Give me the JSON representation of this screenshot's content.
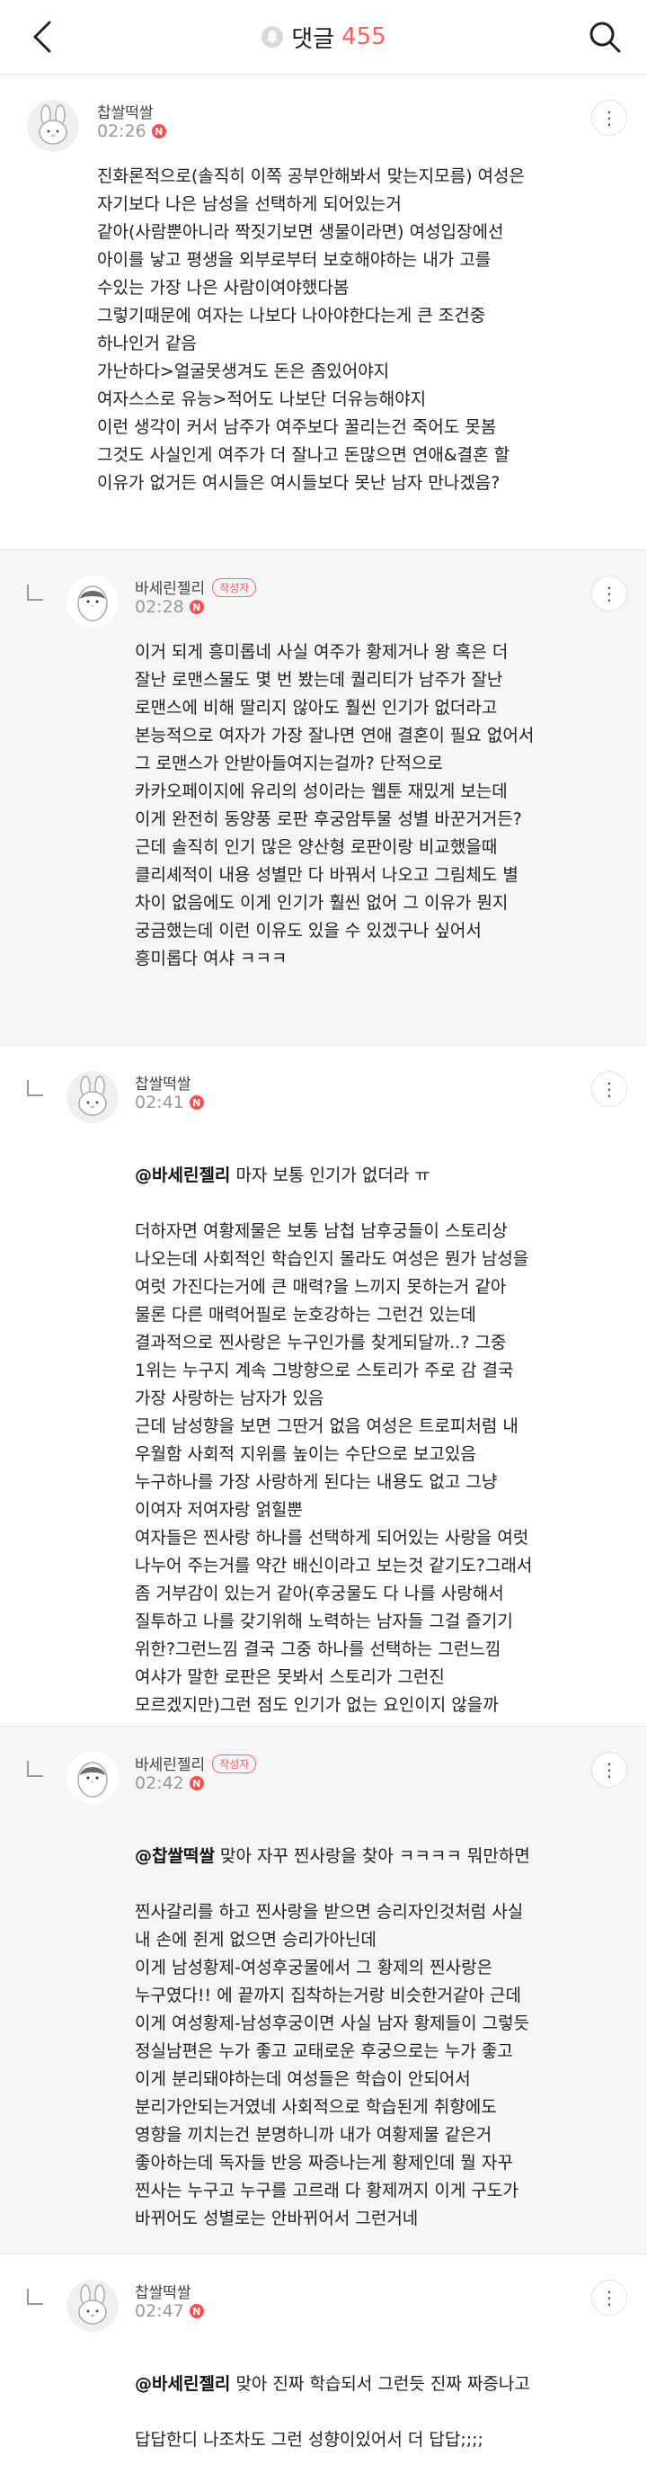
{
  "header": {
    "title": "댓글",
    "count": "455"
  },
  "comments": [
    {
      "author": "찹쌀떡쌀",
      "time": "02:26",
      "badge": "N",
      "body": "진화론적으로(솔직히 이쪽 공부안해봐서 맞는지모름) 여성은\n자기보다 나은 남성을 선택하게 되어있는거\n같아(사람뿐아니라 짝짓기보면 생물이라면) 여성입장에선\n아이를 낳고 평생을 외부로부터 보호해야하는 내가 고를\n수있는 가장 나은 사람이여야했다봄\n그렇기때문에 여자는 나보다 나아야한다는게 큰 조건중\n하나인거 같음\n가난하다>얼굴못생겨도 돈은 좀있어야지\n여자스스로 유능>적어도 나보단 더유능해야지\n이런 생각이 커서 남주가 여주보다 꿀리는건 죽어도 못봄\n그것도 사실인게 여주가 더 잘나고 돈많으면 연애&결혼 할\n이유가 없거든 여시들은 여시들보다 못난 남자 만나겠음?"
    },
    {
      "author": "바세린젤리",
      "tag": "작성자",
      "time": "02:28",
      "badge": "N",
      "body": "이거 되게 흥미롭네 사실 여주가 황제거나 왕 혹은 더\n잘난 로맨스물도 몇 번 봤는데 퀄리티가 남주가 잘난\n로맨스에 비해 딸리지 않아도 훨씬 인기가 없더라고\n본능적으로 여자가 가장 잘나면 연애 결혼이 필요 없어서\n그 로맨스가 안받아들여지는걸까? 단적으로\n카카오페이지에 유리의 성이라는 웹툰 재밌게 보는데\n이게 완전히 동양풍 로판 후궁암투물 성별 바꾼거거든?\n근데 솔직히 인기 많은 양산형 로판이랑 비교했을때\n클리셰적이 내용 성별만 다 바꿔서 나오고 그림체도 별\n차이 없음에도 이게 인기가 훨씬 없어 그 이유가 뭔지\n궁금했는데 이런 이유도 있을 수 있겠구나 싶어서\n흥미롭다 여샤 ㅋㅋㅋ"
    },
    {
      "author": "찹쌀떡쌀",
      "time": "02:41",
      "badge": "N",
      "mention": "@바세린젤리",
      "body_rest": " 마자 보통 인기가 없더라 ㅠ",
      "body": "더하자면 여황제물은 보통 남첩 남후궁들이 스토리상\n나오는데 사회적인 학습인지 몰라도 여성은 뭔가 남성을\n여럿 가진다는거에 큰 매력?을 느끼지 못하는거 같아\n물론 다른 매력어필로 눈호강하는 그런건 있는데\n결과적으로 찐사랑은 누구인가를 찾게되달까..? 그중\n1위는 누구지 계속 그방향으로 스토리가 주로 감 결국\n가장 사랑하는 남자가 있음\n근데 남성향을 보면 그딴거 없음 여성은 트로피처럼 내\n우월함 사회적 지위를 높이는 수단으로 보고있음\n누구하나를 가장 사랑하게 된다는 내용도 없고 그냥\n이여자 저여자랑 얽힐뿐\n여자들은 찐사랑 하나를 선택하게 되어있는 사랑을 여럿\n나누어 주는거를 약간 배신이라고 보는것 같기도?그래서\n좀 거부감이 있는거 같아(후궁물도 다 나를 사랑해서\n질투하고 나를 갖기위해 노력하는 남자들 그걸 즐기기\n위한?그런느낌 결국 그중 하나를 선택하는 그런느낌\n여샤가 말한 로판은 못봐서 스토리가 그런진\n모르겠지만)그런 점도 인기가 없는 요인이지 않을까"
    },
    {
      "author": "바세린젤리",
      "tag": "작성자",
      "time": "02:42",
      "badge": "N",
      "mention": "@찹쌀떡쌀",
      "body_rest": " 맞아 자꾸 찐사랑을 찾아 ㅋㅋㅋㅋ 뭐만하면",
      "body": "찐사갈리를 하고 찐사랑을 받으면 승리자인것처럼 사실\n내 손에 쥔게 없으면 승리가아닌데\n이게 남성황제-여성후궁물에서 그 황제의 찐사랑은\n누구였다!! 에 끝까지 집착하는거랑 비슷한거같아 근데\n이게 여성황제-남성후궁이면 사실 남자 황제들이 그렇듯\n정실남편은 누가 좋고 교태로운 후궁으로는 누가 좋고\n이게 분리돼야하는데 여성들은 학습이 안되어서\n분리가안되는거였네 사회적으로 학습된게 취향에도\n영향을 끼치는건 분명하니까 내가 여황제물 같은거\n좋아하는데 독자들 반응 짜증나는게 황제인데 뭘 자꾸\n찐사는 누구고 누구를 고르래 다 황제꺼지 이게 구도가\n바뀌어도 성별로는 안바뀌어서 그런거네"
    },
    {
      "author": "찹쌀떡쌀",
      "time": "02:47",
      "badge": "N",
      "mention": "@바세린젤리",
      "body_rest": " 맞아 진짜 학습되서 그런듯 진짜 짜증나고",
      "body": "답답한디 나조차도 그런 성향이있어서 더 답답;;;;"
    }
  ]
}
